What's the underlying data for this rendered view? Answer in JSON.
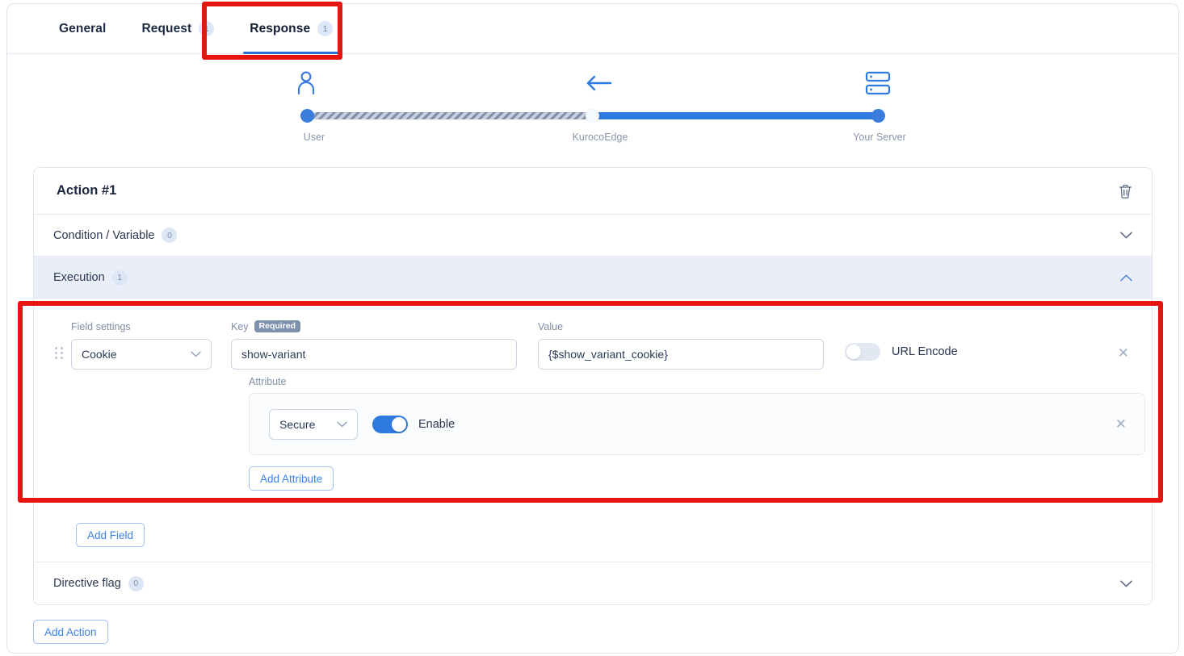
{
  "tabs": [
    {
      "label": "General",
      "badge": null,
      "active": false
    },
    {
      "label": "Request",
      "badge": "1",
      "active": false
    },
    {
      "label": "Response",
      "badge": "1",
      "active": true
    }
  ],
  "flow": {
    "nodes": [
      {
        "caption": "User",
        "icon": "user-icon"
      },
      {
        "caption": "KurocoEdge",
        "icon": "arrow-left-icon"
      },
      {
        "caption": "Your Server",
        "icon": "server-stack-icon"
      }
    ],
    "accent_color": "#2f7ae0",
    "hatch_color": "#7f8fa8"
  },
  "action": {
    "title": "Action #1",
    "delete_icon": "trash-icon",
    "sections": [
      {
        "label": "Condition / Variable",
        "badge": "0",
        "expanded": false,
        "chevron": "chevron-down-icon"
      },
      {
        "label": "Execution",
        "badge": "1",
        "expanded": true,
        "chevron": "chevron-up-icon"
      },
      {
        "label": "Directive flag",
        "badge": "0",
        "expanded": false,
        "chevron": "chevron-down-icon"
      }
    ]
  },
  "execution": {
    "field": {
      "settings_label": "Field settings",
      "settings_value": "Cookie",
      "key_label": "Key",
      "key_required_badge": "Required",
      "key_value": "show-variant",
      "value_label": "Value",
      "value_value": "{$show_variant_cookie}",
      "url_encode_label": "URL Encode",
      "url_encode_on": false,
      "remove_icon": "close-icon"
    },
    "attribute": {
      "label": "Attribute",
      "select_value": "Secure",
      "toggle_label": "Enable",
      "toggle_on": true,
      "remove_icon": "close-icon"
    },
    "add_attribute_label": "Add Attribute",
    "add_field_label": "Add Field"
  },
  "footer": {
    "add_action_label": "Add Action"
  },
  "annotations": {
    "color": "#e8140f",
    "boxes": [
      "response-tab",
      "execution-field-settings"
    ]
  }
}
